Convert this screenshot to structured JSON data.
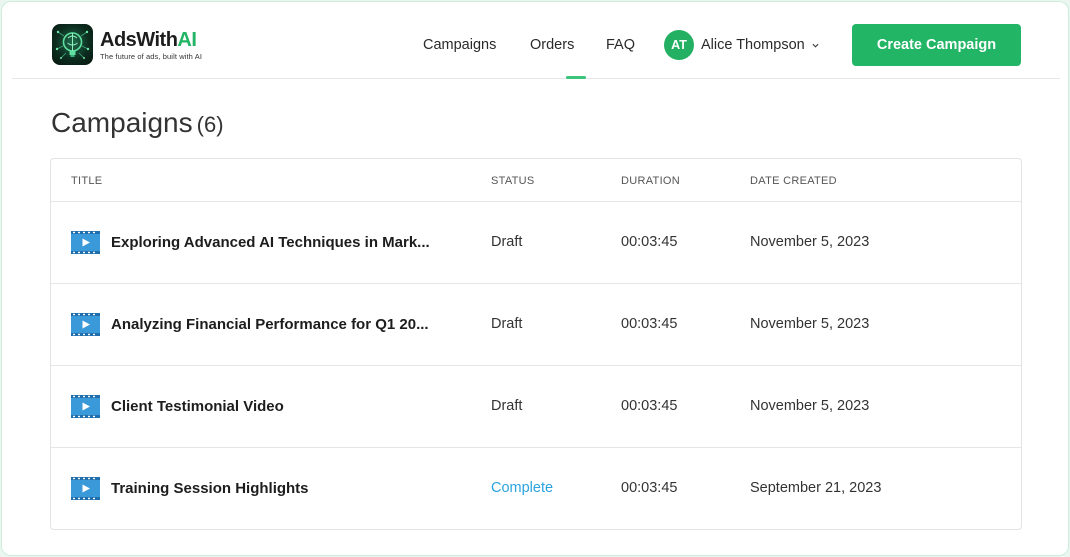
{
  "brand": {
    "name_prefix": "AdsWith",
    "name_suffix": "AI",
    "tagline": "The future of ads, built with AI",
    "accent": "#22b566"
  },
  "nav": {
    "items": [
      {
        "label": "Campaigns",
        "active": true
      },
      {
        "label": "Orders",
        "active": false
      },
      {
        "label": "FAQ",
        "active": false
      }
    ]
  },
  "user": {
    "initials": "AT",
    "name": "Alice Thompson",
    "menu_icon": "chevron-down-icon"
  },
  "actions": {
    "create_label": "Create Campaign"
  },
  "page": {
    "title": "Campaigns",
    "count": "(6)"
  },
  "table": {
    "columns": [
      "TITLE",
      "STATUS",
      "DURATION",
      "DATE CREATED"
    ],
    "rows": [
      {
        "title": "Exploring Advanced AI Techniques in Mark...",
        "status": "Draft",
        "duration": "00:03:45",
        "date": "November 5, 2023",
        "icon": "video-icon"
      },
      {
        "title": "Analyzing Financial Performance for Q1 20...",
        "status": "Draft",
        "duration": "00:03:45",
        "date": "November 5, 2023",
        "icon": "video-icon"
      },
      {
        "title": "Client Testimonial Video",
        "status": "Draft",
        "duration": "00:03:45",
        "date": "November 5, 2023",
        "icon": "video-icon"
      },
      {
        "title": "Training Session Highlights",
        "status": "Complete",
        "duration": "00:03:45",
        "date": "September 21, 2023",
        "icon": "video-icon"
      }
    ],
    "status_colors": {
      "Draft": "#333333",
      "Complete": "#2aa3e0"
    }
  }
}
